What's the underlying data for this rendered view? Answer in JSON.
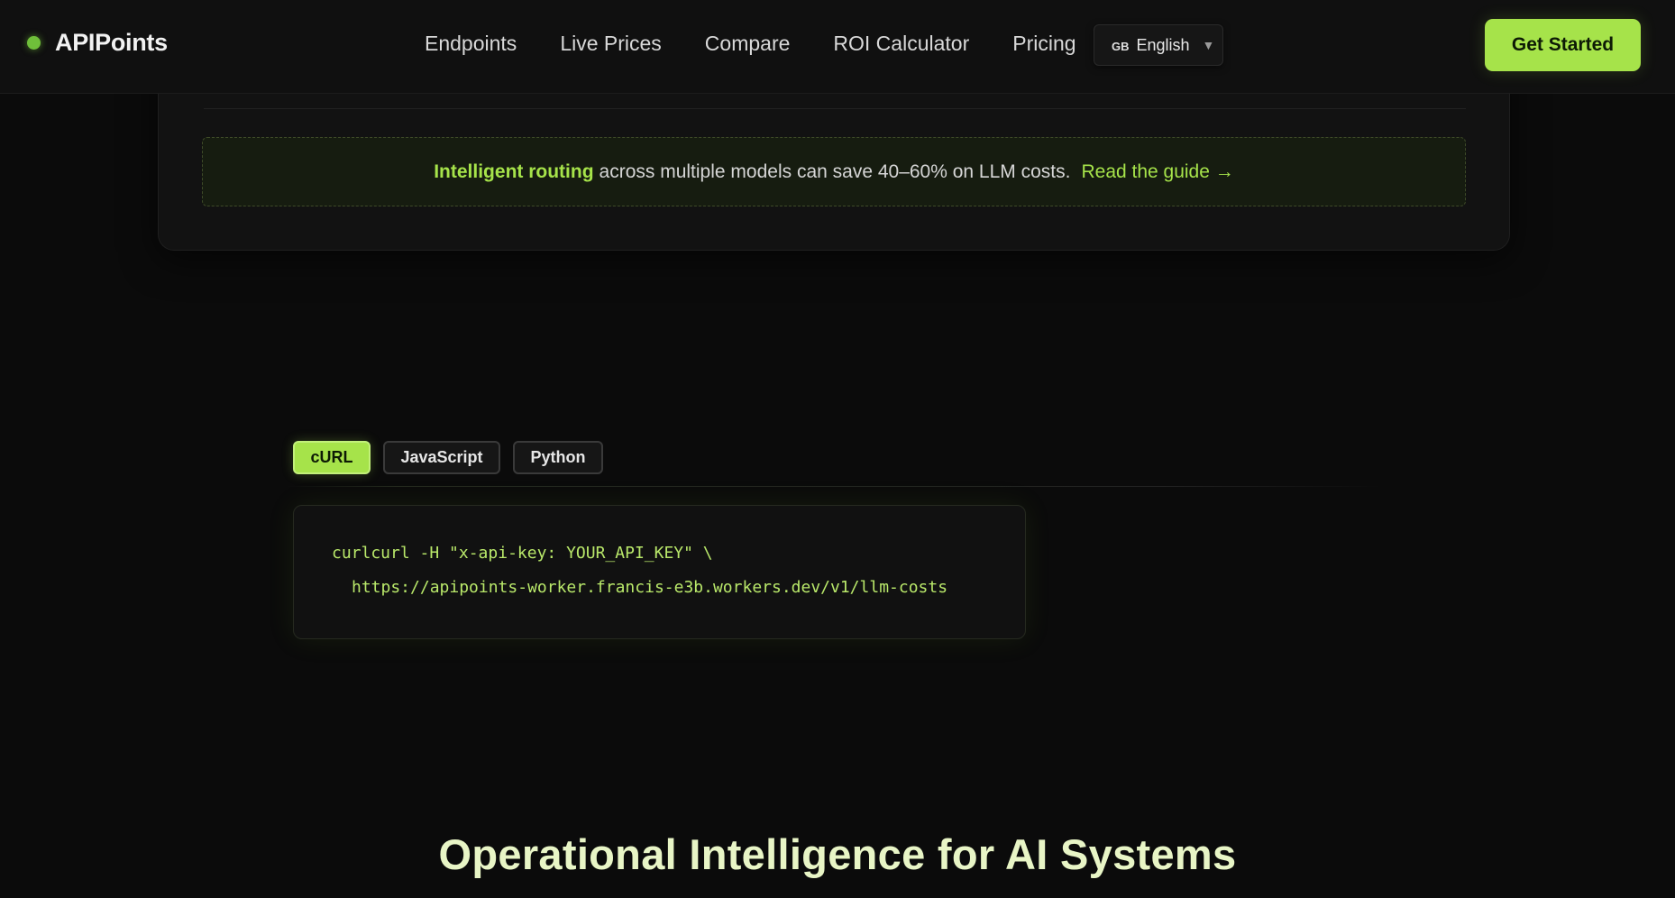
{
  "brand": {
    "name": "APIPoints"
  },
  "nav": {
    "items": [
      "Endpoints",
      "Live Prices",
      "Compare",
      "ROI Calculator",
      "Pricing"
    ]
  },
  "language": {
    "flag": "GB",
    "label": "English",
    "caret": "▼"
  },
  "cta": {
    "label": "Get Started"
  },
  "notice": {
    "strong": "Intelligent routing",
    "text": "across multiple models can save 40–60% on LLM costs.",
    "link": "Read the guide →"
  },
  "code_tabs": {
    "items": [
      "cURL",
      "JavaScript",
      "Python"
    ],
    "active": "cURL"
  },
  "code": {
    "line1": "curlcurl -H \"x-api-key: YOUR_API_KEY\" \\",
    "line2": "https://apipoints-worker.francis-e3b.workers.dev/v1/llm-costs"
  },
  "section": {
    "title": "Operational Intelligence for AI Systems"
  },
  "colors": {
    "accent": "#a6e34a",
    "background": "#0b0b0b"
  }
}
